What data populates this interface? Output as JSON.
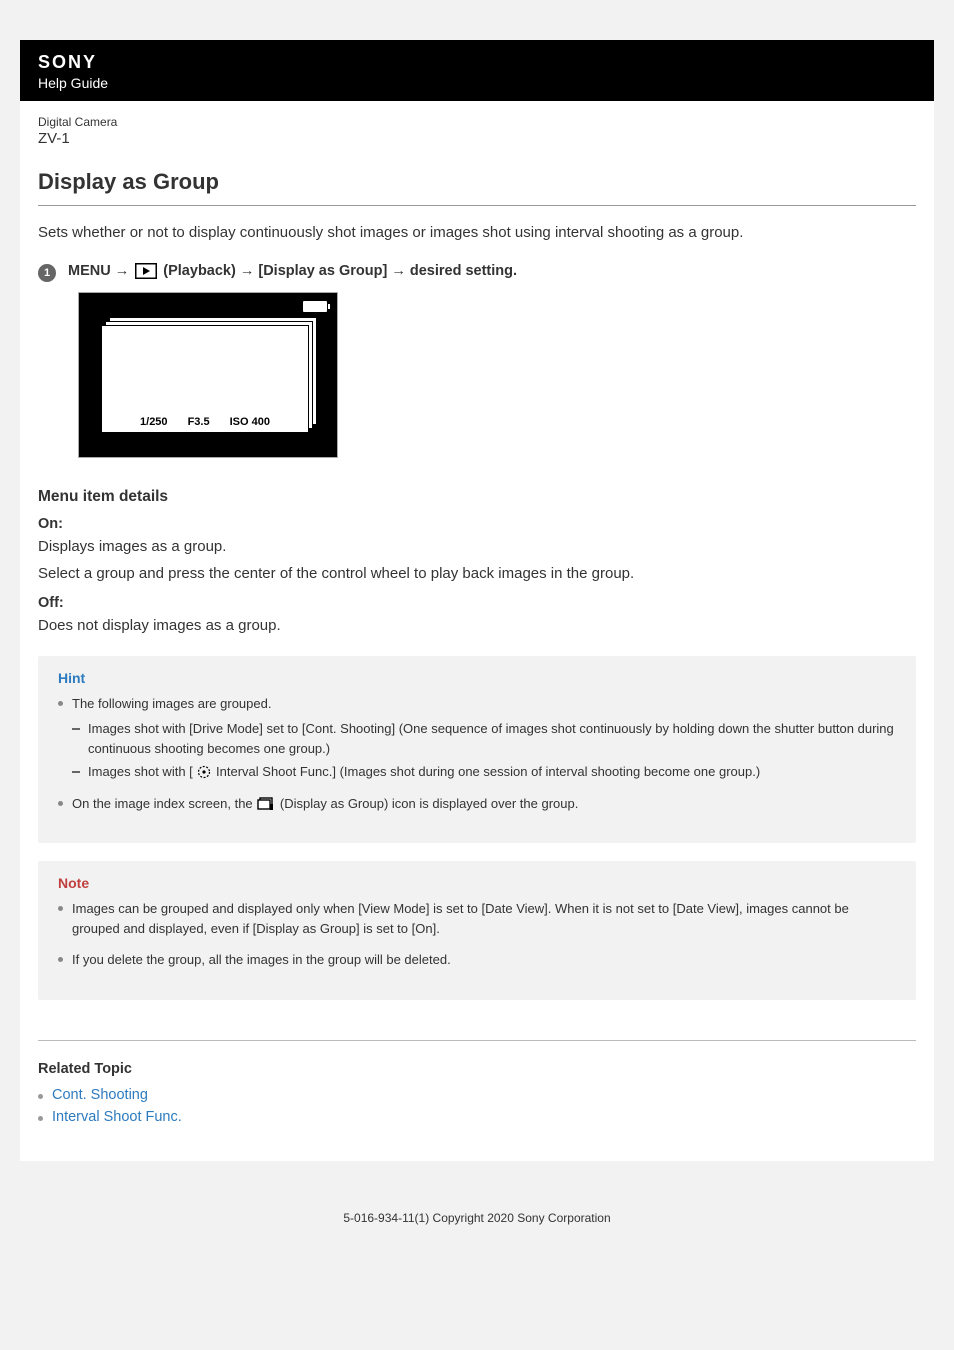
{
  "header": {
    "brand": "SONY",
    "guide": "Help Guide"
  },
  "product": {
    "category": "Digital Camera",
    "model": "ZV-1"
  },
  "title": "Display as Group",
  "intro": "Sets whether or not to display continuously shot images or images shot using interval shooting as a group.",
  "step": {
    "num": "1",
    "menu": "MENU → ",
    "playback": " (Playback) → [Display as Group] → desired setting."
  },
  "illustration": {
    "shutter": "1/250",
    "aperture": "F3.5",
    "iso": "ISO 400"
  },
  "details": {
    "heading": "Menu item details",
    "items": [
      {
        "label": "On:",
        "desc1": "Displays images as a group.",
        "desc2": "Select a group and press the center of the control wheel to play back images in the group."
      },
      {
        "label": "Off:",
        "desc1": "Does not display images as a group."
      }
    ]
  },
  "hint": {
    "title": "Hint",
    "bullet1": "The following images are grouped.",
    "sub1": "Images shot with [Drive Mode] set to [Cont. Shooting] (One sequence of images shot continuously by holding down the shutter button during continuous shooting becomes one group.)",
    "sub2_a": "Images shot with [",
    "sub2_b": "Interval Shoot Func.] (Images shot during one session of interval shooting become one group.)",
    "bullet2_a": "On the image index screen, the ",
    "bullet2_b": " (Display as Group) icon is displayed over the group."
  },
  "note": {
    "title": "Note",
    "bullet1": "Images can be grouped and displayed only when [View Mode] is set to [Date View]. When it is not set to [Date View], images cannot be grouped and displayed, even if [Display as Group] is set to [On].",
    "bullet2": "If you delete the group, all the images in the group will be deleted."
  },
  "related": {
    "heading": "Related Topic",
    "links": [
      "Cont. Shooting",
      "Interval Shoot Func."
    ]
  },
  "footer": "5-016-934-11(1) Copyright 2020 Sony Corporation"
}
